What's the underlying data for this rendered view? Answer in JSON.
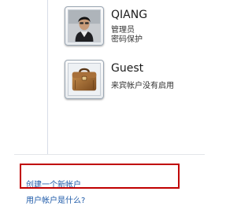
{
  "accounts": [
    {
      "name": "QIANG",
      "lines": [
        "管理员",
        "密码保护"
      ],
      "avatar_icon": "user-photo-icon"
    },
    {
      "name": "Guest",
      "lines": [
        "来宾帐户没有启用"
      ],
      "avatar_icon": "briefcase-icon"
    }
  ],
  "links": {
    "create_account": "创建一个新帐户",
    "what_is_account": "用户帐户是什么?"
  },
  "colors": {
    "link": "#1e5aa8",
    "highlight": "#c00000"
  }
}
